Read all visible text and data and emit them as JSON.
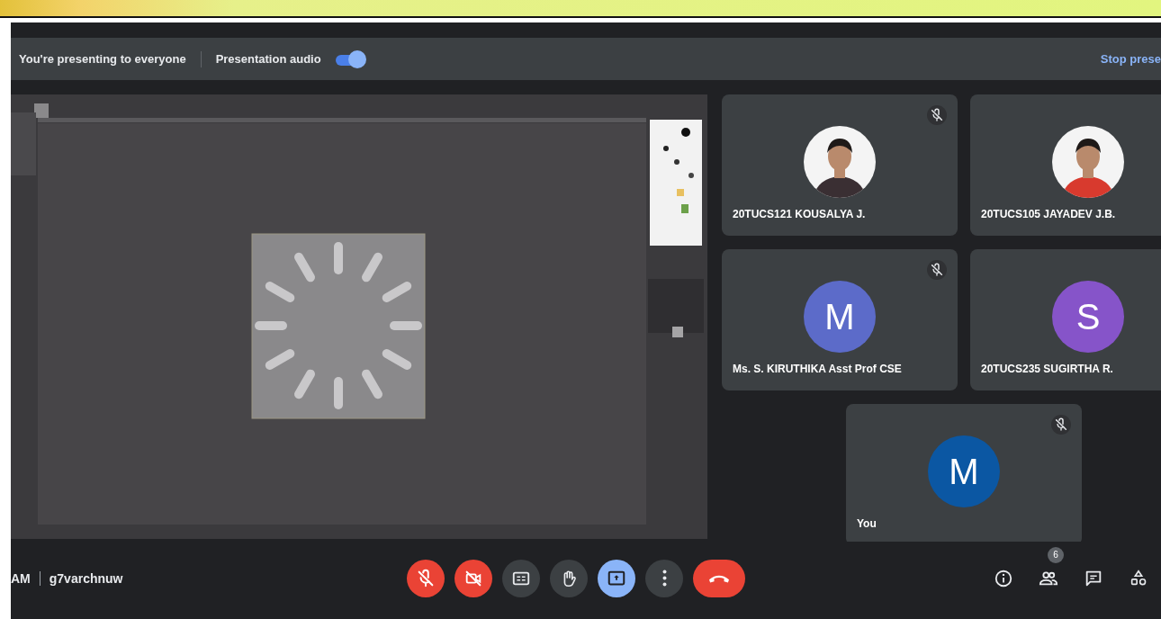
{
  "presenting_bar": {
    "message": "You're presenting to everyone",
    "audio_label": "Presentation audio",
    "audio_on": true,
    "stop_button": "Stop prese"
  },
  "participants": [
    {
      "name": "20TUCS121 KOUSALYA J.",
      "muted": true
    },
    {
      "name": "20TUCS105 JAYADEV J.B."
    },
    {
      "name": "Ms. S. KIRUTHIKA Asst Prof CSE",
      "avatar": {
        "kind": "letter",
        "letter": "M",
        "color": "#5c6bc9"
      },
      "muted": true
    },
    {
      "name": "20TUCS235 SUGIRTHA R.",
      "avatar": {
        "kind": "letter",
        "letter": "S",
        "color": "#8654c9"
      }
    },
    {
      "name": "You",
      "avatar": {
        "kind": "letter",
        "letter": "M",
        "color": "#0b57a3"
      },
      "muted": true
    }
  ],
  "meeting_info": {
    "time": "AM",
    "code": "g7varchnuw"
  },
  "controls": [
    {
      "kind": "mic",
      "off": true
    },
    {
      "kind": "camera",
      "off": true
    },
    {
      "kind": "captions",
      "off": false
    },
    {
      "kind": "hand",
      "off": false
    },
    {
      "kind": "present",
      "off": false,
      "active": true
    },
    {
      "kind": "more",
      "off": false
    },
    {
      "kind": "hangup"
    }
  ],
  "side_controls": [
    {
      "kind": "info"
    },
    {
      "kind": "people",
      "badge": "6"
    },
    {
      "kind": "chat"
    },
    {
      "kind": "activities"
    }
  ]
}
